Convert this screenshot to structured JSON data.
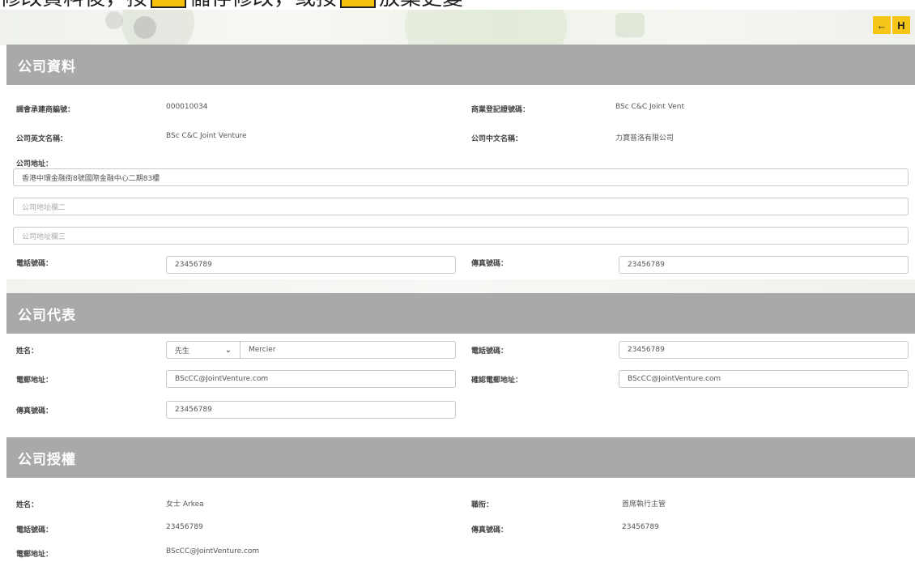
{
  "instruction": {
    "text_before": "修改資料後，按",
    "text_middle": "儲存修改，或按",
    "text_after": "放棄更變"
  },
  "nav": {
    "back_label": "←",
    "save_label": "H"
  },
  "company_info": {
    "header": "公司資料",
    "reg_no_label": "調會承建商編號：",
    "reg_no_value": "000010034",
    "br_label": "商業登記證號碼：",
    "br_value": "BSc C&C Joint Vent",
    "name_en_label": "公司英文名稱：",
    "name_en_value": "BSc C&C Joint Venture",
    "name_zh_label": "公司中文名稱：",
    "name_zh_value": "力寶普洛有限公司",
    "address_label": "公司地址：",
    "address_line1": "香港中環金融街8號國際金融中心二期83樓",
    "address_line2_placeholder": "公司地址欄二",
    "address_line3_placeholder": "公司地址欄三",
    "phone_label": "電話號碼：",
    "phone_value": "23456789",
    "fax_label": "傳真號碼：",
    "fax_value": "23456789"
  },
  "representative": {
    "header": "公司代表",
    "name_label": "姓名：",
    "title_value": "先生",
    "surname_value": "Mercier",
    "phone_label": "電話號碼：",
    "phone_value": "23456789",
    "email_label": "電郵地址：",
    "email_value": "BScCC@JointVenture.com",
    "confirm_email_label": "確認電郵地址：",
    "confirm_email_value": "BScCC@JointVenture.com",
    "fax_label": "傳真號碼：",
    "fax_value": "23456789"
  },
  "authorized": {
    "header": "公司授權",
    "name_label": "姓名：",
    "name_value": "女士 Arkea",
    "position_label": "職衔：",
    "position_value": "首席執行主管",
    "phone_label": "電話號碼：",
    "phone_value": "23456789",
    "fax_label": "傳真號碼：",
    "fax_value": "23456789",
    "email_label": "電郵地址：",
    "email_value": "BScCC@JointVenture.com"
  },
  "colors": {
    "header_bg": "#a9a9a9",
    "accent": "#f5c518"
  }
}
